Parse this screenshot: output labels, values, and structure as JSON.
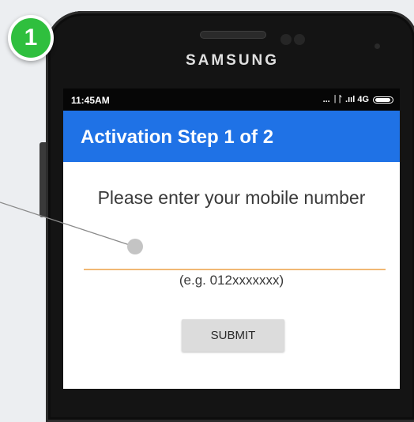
{
  "step_badge": "1",
  "device": {
    "brand": "SAMSUNG"
  },
  "status_bar": {
    "time": "11:45AM",
    "indicators": "... ᛁᛚ .ııl 4G",
    "icons": [
      "signal-icon",
      "network-4g-icon",
      "battery-icon"
    ]
  },
  "app_bar": {
    "title": "Activation Step 1 of 2"
  },
  "form": {
    "prompt": "Please enter your mobile number",
    "mobile_input_value": "",
    "hint": "(e.g. 012xxxxxxx)",
    "submit_label": "SUBMIT"
  },
  "colors": {
    "app_bar": "#1f72e6",
    "badge": "#2fbf3e",
    "input_underline": "#f1b874",
    "button": "#dcdcdc"
  }
}
